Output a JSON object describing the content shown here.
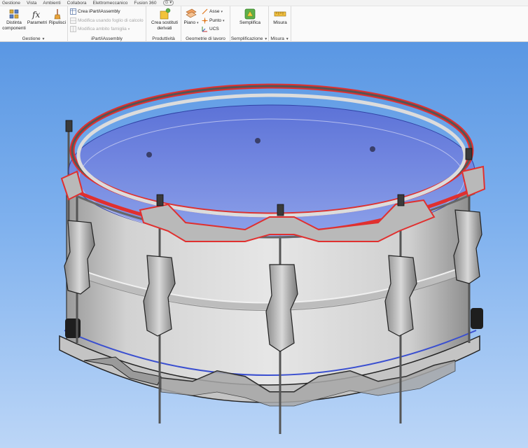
{
  "tabs": [
    "Gestione",
    "Vista",
    "Ambienti",
    "Collabora",
    "Elettromeccanico",
    "Fusion 360"
  ],
  "tab_extra": "⊙ ▾",
  "ribbon": {
    "gestione": {
      "label": "Gestione",
      "distinta": "Distinta componenti",
      "parametri": "Parametri",
      "ripulisci": "Ripulisci"
    },
    "ipart": {
      "label": "iPart/iAssembly",
      "crea": "Crea iPart/iAssembly",
      "modifica_foglio": "Modifica usando foglio di calcolo",
      "modifica_ambito": "Modifica ambito famiglia"
    },
    "produttivita": {
      "label": "Produttività",
      "crea_sostituti": "Crea sostituti derivati"
    },
    "geometrie": {
      "label": "Geometrie di lavoro",
      "piano": "Piano",
      "asse": "Asse",
      "punto": "Punto",
      "ucs": "UCS"
    },
    "semplificazione": {
      "label": "Semplificazione",
      "semplifica": "Semplifica"
    },
    "misura": {
      "label": "Misura",
      "misura_btn": "Misura"
    }
  },
  "colors": {
    "viewport_top": "#5a97e3",
    "viewport_bottom": "#bcd6f7",
    "shell": "#c9c9c9",
    "hoop_highlight": "#e0302f"
  }
}
